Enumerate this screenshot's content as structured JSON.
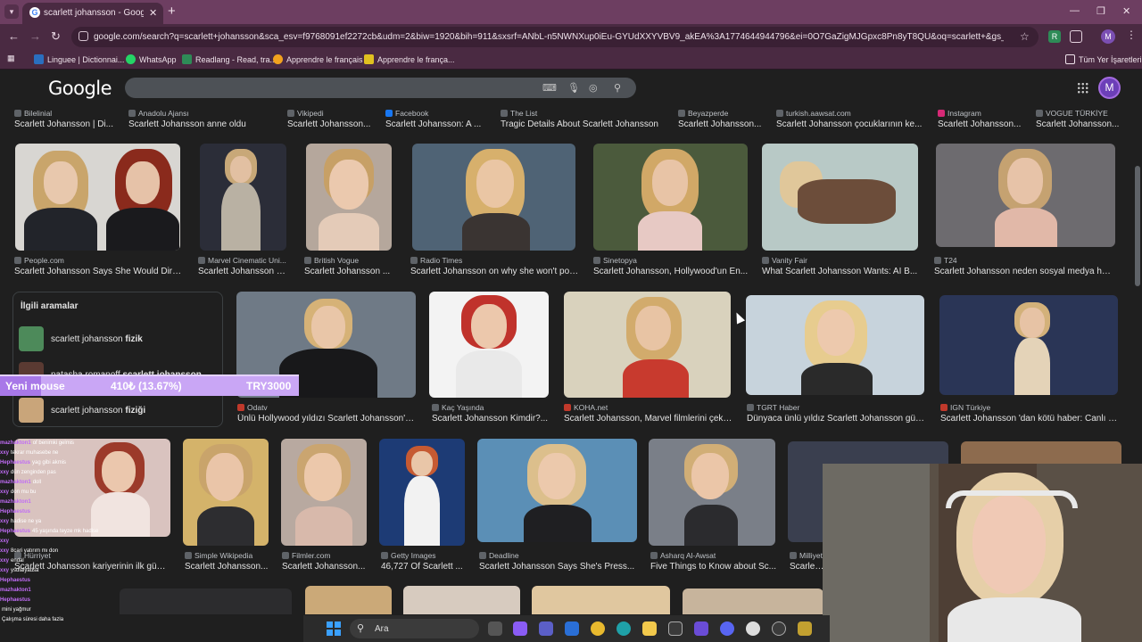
{
  "browser": {
    "tab_title": "scarlett johansson - Google'da Ara",
    "url": "google.com/search?q=scarlett+johansson&sca_esv=f9768091ef2272cb&udm=2&biw=1920&bih=911&sxsrf=ANbL-n5NWNXup0iEu-GYUdXXYVBV9_akEA%3A1774644944796&ei=0O7GaZigMJGpxc8Pn8yT8QU&oq=scarlett+&gs_lp=Egtnd3Mtd2l6Ll...",
    "profile_initial": "M",
    "ext_initial": "R",
    "icons": {
      "back": "back-arrow-icon",
      "forward": "forward-arrow-icon",
      "reload": "reload-icon",
      "star": "star-icon",
      "extensions": "puzzle-icon",
      "menu": "kebab-menu-icon"
    },
    "bookmarks": [
      {
        "label": "Linguee | Dictionnai...",
        "color": "#2a6fbf"
      },
      {
        "label": "WhatsApp",
        "color": "#25d366"
      },
      {
        "label": "Readlang - Read, tra...",
        "color": "#2e8b57"
      },
      {
        "label": "Apprendre le français",
        "color": "#f2a21e"
      },
      {
        "label": "Apprendre le françа...",
        "color": "#e0c020"
      }
    ],
    "all_bookmarks_label": "Tüm Yer İşaretleri"
  },
  "google": {
    "logo": "Google",
    "avatar_initial": "M"
  },
  "row1": [
    {
      "source": "Bilelinial",
      "caption": "Scarlett Johansson | Di..."
    },
    {
      "source": "Anadolu Ajansı",
      "caption": "Scarlett Johansson anne oldu"
    },
    {
      "source": "Vikipedi",
      "caption": "Scarlett Johansson..."
    },
    {
      "source": "Facebook",
      "caption": "Scarlett Johansson: A ..."
    },
    {
      "source": "The List",
      "caption": "Tragic Details About Scarlett Johansson"
    },
    {
      "source": "Beyazperde",
      "caption": "Scarlett Johansson..."
    },
    {
      "source": "turkish.aawsat.com",
      "caption": "Scarlett Johansson çocuklarının ke..."
    },
    {
      "source": "Instagram",
      "caption": "Scarlett Johansson..."
    },
    {
      "source": "VOGUE TÜRKİYE",
      "caption": "Scarlett Johansson..."
    }
  ],
  "row2": [
    {
      "source": "People.com",
      "caption": "Scarlett Johansson Says She Would Dire..."
    },
    {
      "source": "Marvel Cinematic Uni...",
      "caption": "Scarlett Johansson | ..."
    },
    {
      "source": "British Vogue",
      "caption": "Scarlett Johansson ..."
    },
    {
      "source": "Radio Times",
      "caption": "Scarlett Johansson on why she won't polit..."
    },
    {
      "source": "Sinetopya",
      "caption": "Scarlett Johansson, Hollywood'un En..."
    },
    {
      "source": "Vanity Fair",
      "caption": "What Scarlett Johansson Wants: AI B..."
    },
    {
      "source": "T24",
      "caption": "Scarlett Johansson neden sosyal medya hes..."
    }
  ],
  "related": {
    "title": "İlgili aramalar",
    "items": [
      {
        "prefix": "scarlett johansson ",
        "bold": "fizik"
      },
      {
        "prefix": "natasha romanoff ",
        "bold": "scarlett johansson"
      },
      {
        "prefix": "scarlett johansson ",
        "bold": "fiziği"
      }
    ]
  },
  "row3": [
    {
      "source": "Odatv",
      "caption": "Ünlü Hollywood yıldızı Scarlett Johansson'd..."
    },
    {
      "source": "Kaç Yaşında",
      "caption": "Scarlett Johansson Kimdir?..."
    },
    {
      "source": "KOHA.net",
      "caption": "Scarlett Johansson, Marvel filmlerini çeke..."
    },
    {
      "source": "TGRT Haber",
      "caption": "Dünyaca ünlü yıldız Scarlett Johansson güz..."
    },
    {
      "source": "IGN Türkiye",
      "caption": "Scarlett Johansson 'dan kötü haber: Canlı ç..."
    }
  ],
  "row4": [
    {
      "source": "Hürriyet",
      "caption": "Scarlett Johansson kariyerinin ilk günl..."
    },
    {
      "source": "Simple Wikipedia",
      "caption": "Scarlett Johansson..."
    },
    {
      "source": "Filmler.com",
      "caption": "Scarlett Johansson..."
    },
    {
      "source": "Getty Images",
      "caption": "46,727 Of Scarlett ..."
    },
    {
      "source": "Deadline",
      "caption": "Scarlett Johansson Says She's Press..."
    },
    {
      "source": "Asharq Al-Awsat",
      "caption": "Five Things to Know about Sc..."
    },
    {
      "source": "Milliyet",
      "caption": "Scarlett ..."
    }
  ],
  "overlay": {
    "goal_label": "Yeni mouse",
    "goal_progress": "410₺ (13.67%)",
    "goal_progress_fraction": 0.1367,
    "goal_target": "TRY3000",
    "chat": [
      {
        "user": "mazhakton1",
        "msg": "of benimki gelmis"
      },
      {
        "user": "xxy",
        "msg": "tekrar muhasebe ne"
      },
      {
        "user": "Hephaestus",
        "msg": "yag gibi akmis"
      },
      {
        "user": "xxy",
        "msg": "dün zenginden pas"
      },
      {
        "user": "mazhakton1",
        "msg": "doll"
      },
      {
        "user": "xxy",
        "msg": "don mu bu"
      },
      {
        "user": "mazhakton1",
        "msg": ""
      },
      {
        "user": "Hephaestus",
        "msg": ""
      },
      {
        "user": "xxy",
        "msg": "hadise ne ya"
      },
      {
        "user": "Hephaestus",
        "msg": "45 yaşında teyze mk hadise"
      },
      {
        "user": "xxy",
        "msg": ""
      },
      {
        "user": "xxy",
        "msg": "8cari yatırım mı don"
      },
      {
        "user": "xxy",
        "msg": "endal"
      },
      {
        "user": "xxy",
        "msg": "ysdlalyadsa"
      },
      {
        "user": "Hephaestus",
        "msg": ""
      },
      {
        "user": "mazhakton1",
        "msg": ""
      },
      {
        "user": "Hephaestus",
        "msg": ""
      },
      {
        "user": "",
        "msg": "mini yağmur"
      },
      {
        "user": "",
        "msg": "Çalışma süresi daha fazla"
      }
    ]
  },
  "taskbar": {
    "search_label": "Ara"
  }
}
